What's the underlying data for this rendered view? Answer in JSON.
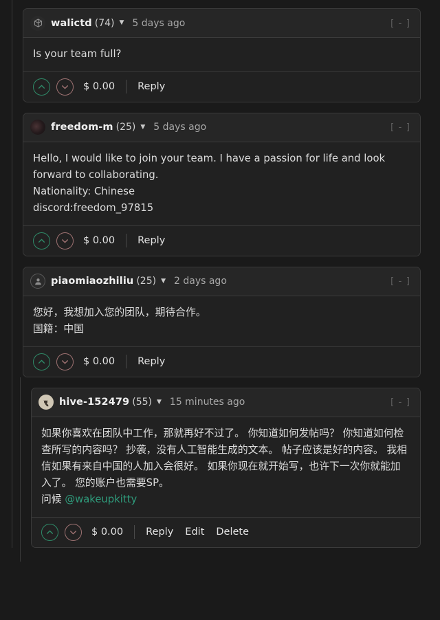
{
  "theme": {
    "background": "#1a1a1a",
    "card_background": "#212121",
    "header_background": "#262626",
    "border": "#3b3b3b",
    "text": "#dcdcdc",
    "muted_text": "#a8a8a8",
    "upvote_color": "#2f8a68",
    "downvote_color": "#9e7272",
    "link_color": "#2f9c7c"
  },
  "collapse_toggle_label": "[ - ]",
  "comments": [
    {
      "author": "walictd",
      "reputation": "(74)",
      "timestamp": "5 days ago",
      "avatar": "cube-avatar-icon",
      "depth": 1,
      "body_lines": [
        "Is your team full?"
      ],
      "payout": "$ 0.00",
      "actions": [
        "Reply"
      ]
    },
    {
      "author": "freedom-m",
      "reputation": "(25)",
      "timestamp": "5 days ago",
      "avatar": "photo-avatar-icon",
      "depth": 1,
      "body_lines": [
        "Hello, I would like to join your team. I have a passion for life and look forward to collaborating.",
        "Nationality: Chinese",
        "discord:freedom_97815"
      ],
      "payout": "$ 0.00",
      "actions": [
        "Reply"
      ]
    },
    {
      "author": "piaomiaozhiliu",
      "reputation": "(25)",
      "timestamp": "2 days ago",
      "avatar": "silhouette-avatar-icon",
      "depth": 1,
      "body_lines": [
        "您好，我想加入您的团队，期待合作。",
        "国籍：中国"
      ],
      "payout": "$ 0.00",
      "actions": [
        "Reply"
      ]
    },
    {
      "author": "hive-152479",
      "reputation": "(55)",
      "timestamp": "15 minutes ago",
      "avatar": "cat-avatar-icon",
      "depth": 2,
      "body_lines": [
        "如果你喜欢在团队中工作，那就再好不过了。 你知道如何发帖吗？ 你知道如何检查所写的内容吗？ 抄袭，没有人工智能生成的文本。 帖子应该是好的内容。 我相信如果有来自中国的人加入会很好。 如果你现在就开始写，也许下一次你就能加入了。 您的账户也需要SP。"
      ],
      "greeting_prefix": "问候 ",
      "mention": "@wakeupkitty",
      "payout": "$ 0.00",
      "actions": [
        "Reply",
        "Edit",
        "Delete"
      ]
    }
  ]
}
